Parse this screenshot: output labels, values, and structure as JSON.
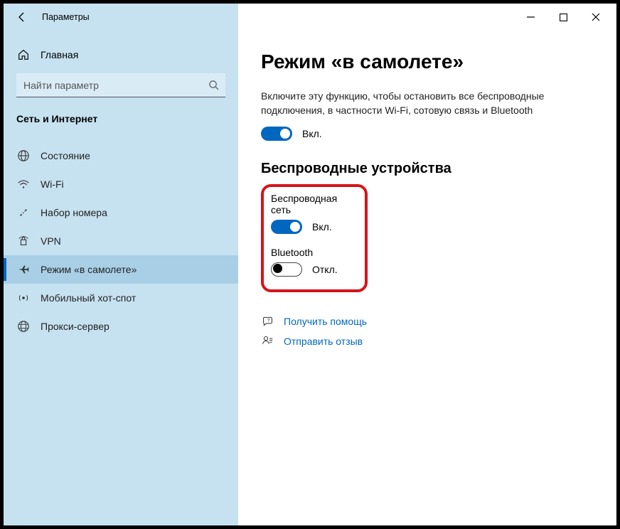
{
  "titlebar": {
    "app_title": "Параметры"
  },
  "sidebar": {
    "home_label": "Главная",
    "search": {
      "placeholder": "Найти параметр"
    },
    "category_header": "Сеть и Интернет",
    "items": [
      {
        "label": "Состояние",
        "icon": "globe-icon",
        "selected": false
      },
      {
        "label": "Wi-Fi",
        "icon": "wifi-icon",
        "selected": false
      },
      {
        "label": "Набор номера",
        "icon": "dialup-icon",
        "selected": false
      },
      {
        "label": "VPN",
        "icon": "vpn-icon",
        "selected": false
      },
      {
        "label": "Режим «в самолете»",
        "icon": "airplane-icon",
        "selected": true
      },
      {
        "label": "Мобильный хот-спот",
        "icon": "hotspot-icon",
        "selected": false
      },
      {
        "label": "Прокси-сервер",
        "icon": "proxy-icon",
        "selected": false
      }
    ]
  },
  "main": {
    "page_heading": "Режим «в самолете»",
    "description": "Включите эту функцию, чтобы остановить все беспроводные подключения, в частности Wi-Fi, сотовую связь и Bluetooth",
    "airplane_toggle": {
      "state_text": "Вкл.",
      "on": true
    },
    "wireless_section_heading": "Беспроводные устройства",
    "wireless": {
      "wifi_label": "Беспроводная сеть",
      "wifi_toggle": {
        "state_text": "Вкл.",
        "on": true
      },
      "bt_label": "Bluetooth",
      "bt_toggle": {
        "state_text": "Откл.",
        "on": false
      }
    },
    "links": {
      "help": "Получить помощь",
      "feedback": "Отправить отзыв"
    }
  },
  "colors": {
    "accent": "#0067c0",
    "highlight_border": "#d4141a"
  }
}
